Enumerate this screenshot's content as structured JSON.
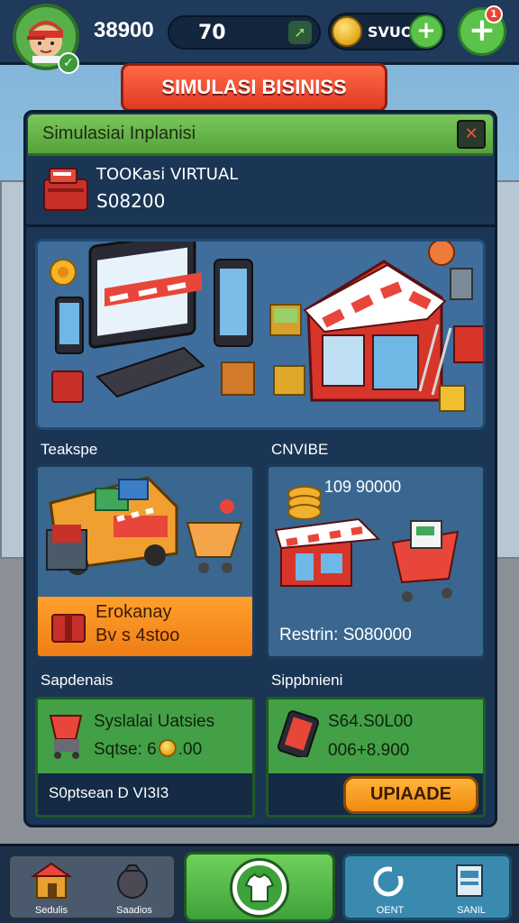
{
  "top_bar": {
    "money": "38900",
    "level": "70",
    "coins": "SVUO",
    "notification_count": "1"
  },
  "title_banner": "SIMULASI BISINISS",
  "panel": {
    "header": "Simulasiai Inplanisi",
    "store": {
      "name": "TOOKasi VIRTUAL",
      "value": "S08200"
    },
    "section_left": "Teakspe",
    "section_right": "CNVIBE",
    "card_left": {
      "line1": "Erokanay",
      "line2": "Bv s 4stoo"
    },
    "card_right": {
      "price": "109 90000",
      "footer": "Restrin:  S080000"
    },
    "section_bottom_left": "Sapdenais",
    "section_bottom_right": "Sippbnieni",
    "green_left": {
      "line1": "Syslalai Uatsies",
      "line2": "Sqtse: 6",
      "line2_suffix": ".00",
      "strip": "S0ptsean D VI3I3"
    },
    "green_right": {
      "line1": "S64.S0L00",
      "line2": "006+8.900"
    },
    "upgrade_label": "UPIAADE"
  },
  "bottom_nav": {
    "left_a": "Sedulis",
    "left_b": "Saadios",
    "right_a": "OENT",
    "right_b": "SANIL"
  },
  "colors": {
    "accent_green": "#5cc24a",
    "title_red": "#e03a22",
    "panel_blue": "#1b3555",
    "orange": "#f08a10"
  }
}
